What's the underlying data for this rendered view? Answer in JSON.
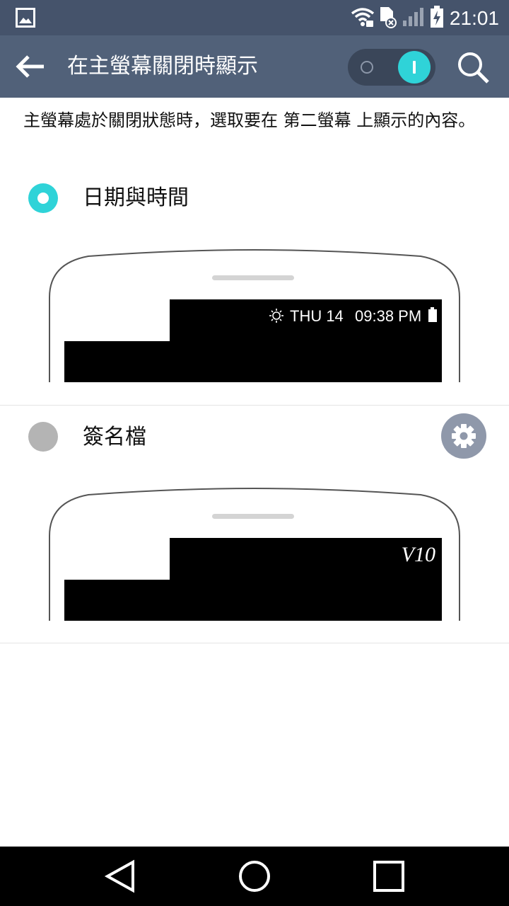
{
  "status_bar": {
    "time": "21:01",
    "icons": [
      "image-notification-icon",
      "wifi-icon",
      "sd-card-icon",
      "signal-icon",
      "battery-charging-icon"
    ]
  },
  "action_bar": {
    "title": "在主螢幕關閉時顯示",
    "toggle_on": true,
    "icons": [
      "back-arrow-icon",
      "search-icon"
    ]
  },
  "description": "主螢幕處於關閉狀態時，選取要在 第二螢幕 上顯示的內容。",
  "options": [
    {
      "label": "日期與時間",
      "selected": true,
      "preview": {
        "day": "THU 14",
        "time": "09:38 PM"
      }
    },
    {
      "label": "簽名檔",
      "selected": false,
      "preview": {
        "signature": "V10"
      },
      "settings_icon": "gear-icon"
    }
  ],
  "colors": {
    "status_bar_bg": "#45536b",
    "action_bar_bg": "#516179",
    "accent": "#2fd3d8"
  },
  "nav_bar": {
    "icons": [
      "nav-back-icon",
      "nav-home-icon",
      "nav-recents-icon"
    ]
  }
}
